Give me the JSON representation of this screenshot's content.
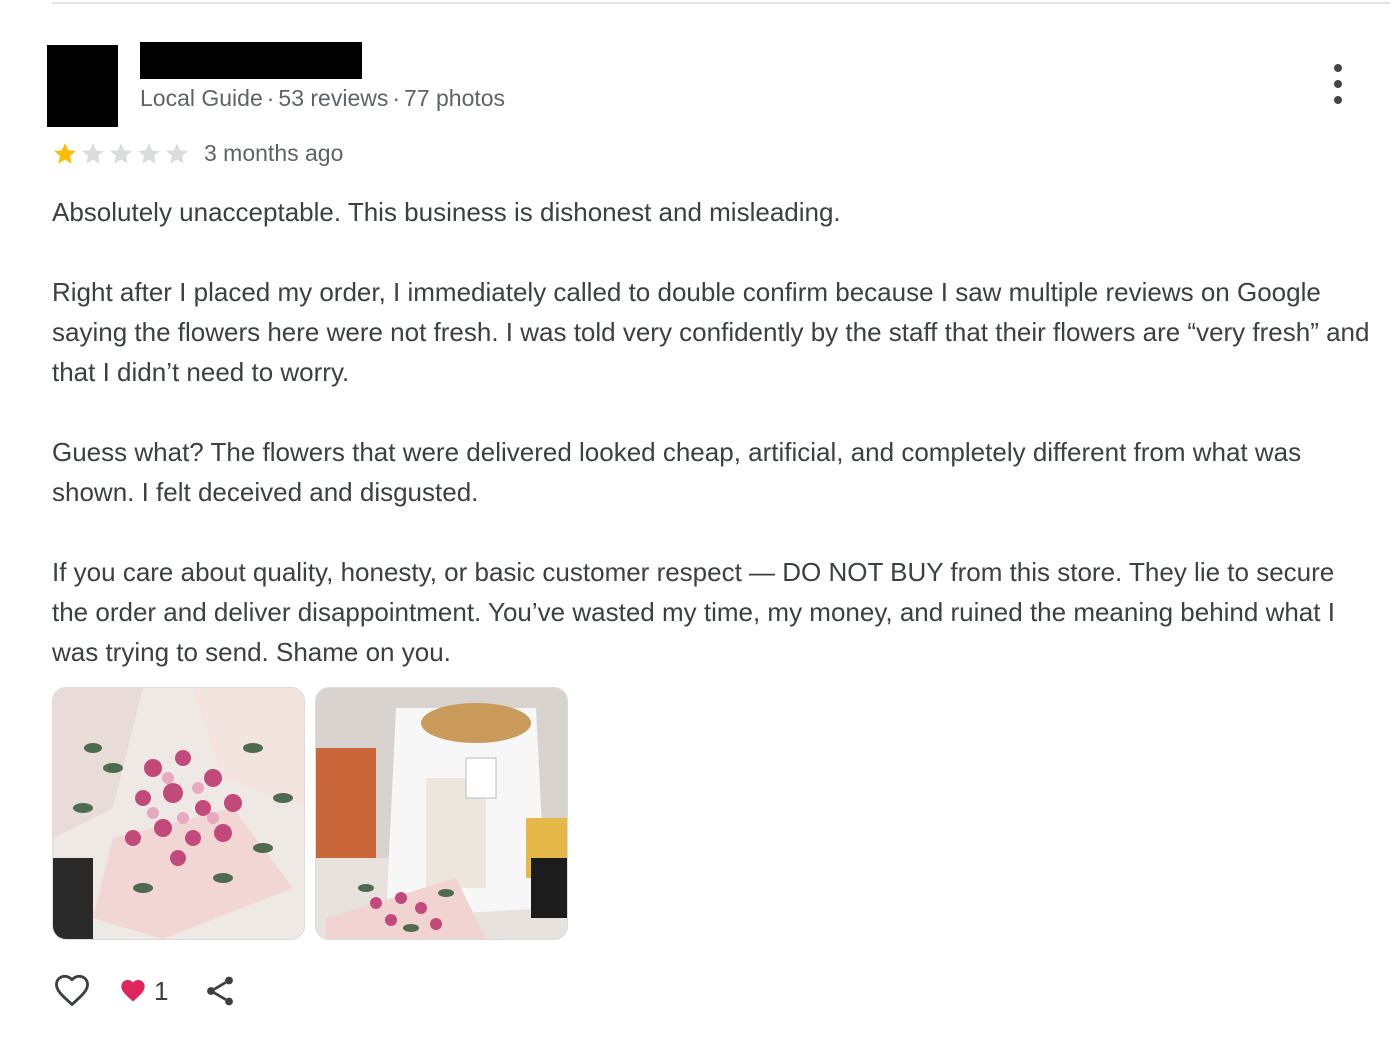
{
  "reviewer": {
    "meta": [
      "Local Guide",
      "53 reviews",
      "77 photos"
    ],
    "separator": "·"
  },
  "review": {
    "rating": 1,
    "rating_max": 5,
    "time": "3 months ago",
    "paragraphs": [
      "Absolutely unacceptable. This business is dishonest and misleading.",
      "Right after I placed my order, I immediately called to double confirm because I saw multiple reviews on Google saying the flowers here were not fresh. I was told very confidently by the staff that their flowers are “very fresh” and that I didn’t need to worry.",
      "Guess what? The flowers that were delivered looked cheap, artificial, and completely different from what was shown. I felt deceived and disgusted.",
      "If you care about quality, honesty, or basic customer respect — DO NOT BUY from this store. They lie to secure the order and deliver disappointment. You’ve wasted my time, my money, and ruined the meaning behind what I was trying to send. Shame on you."
    ]
  },
  "actions": {
    "like_count": "1",
    "icons": [
      "heart-outline-icon",
      "heart-filled-icon",
      "share-icon",
      "more-vert-icon"
    ]
  },
  "colors": {
    "star_filled": "#fbbc04",
    "star_empty": "#dadce0",
    "text": "#3c4043",
    "meta_text": "#5f6368",
    "heart_red": "#e0245e"
  }
}
